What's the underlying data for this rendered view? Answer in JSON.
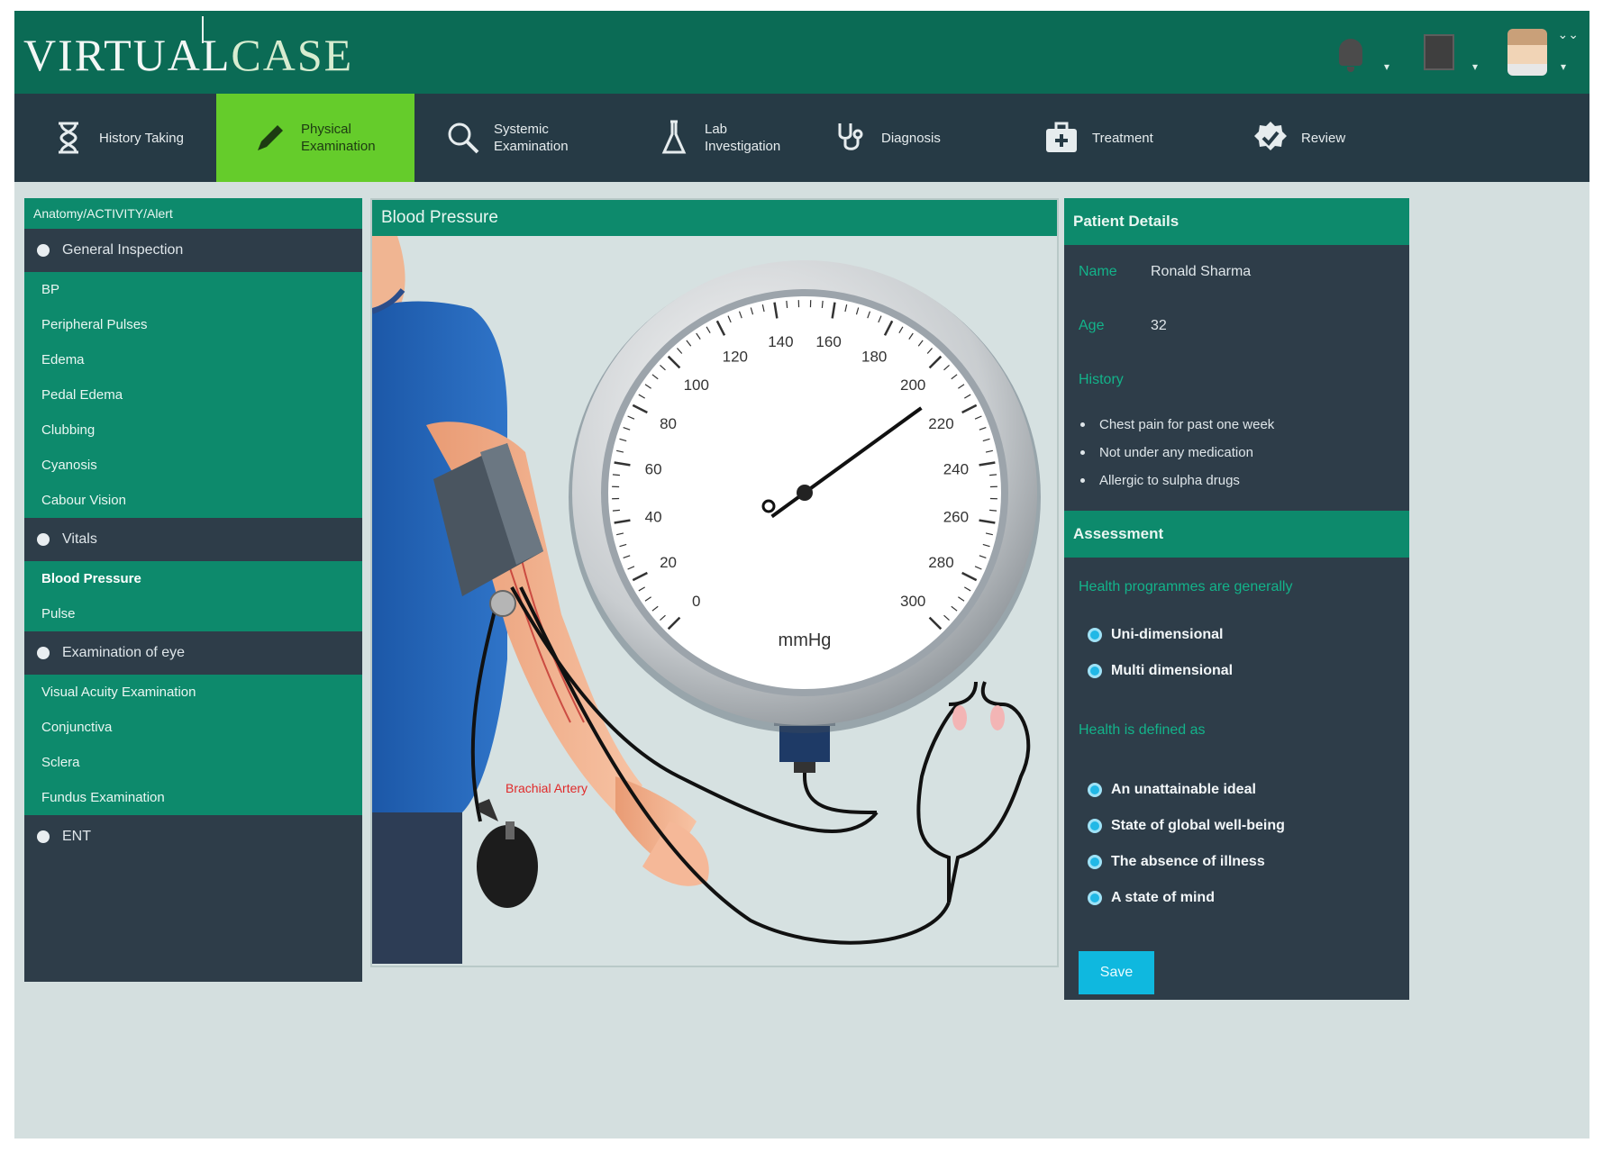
{
  "app": {
    "logo_a": "VIRTUAL",
    "logo_b": "CASE"
  },
  "nav": [
    {
      "label": "History Taking",
      "icon": "hourglass-icon"
    },
    {
      "label": "Physical\nExamination",
      "icon": "pencil-icon",
      "active": true
    },
    {
      "label": "Systemic\nExamination",
      "icon": "search-icon"
    },
    {
      "label": "Lab\nInvestigation",
      "icon": "flask-icon"
    },
    {
      "label": "Diagnosis",
      "icon": "stethoscope-icon"
    },
    {
      "label": "Treatment",
      "icon": "medical-kit-icon"
    },
    {
      "label": "Review",
      "icon": "review-badge-icon"
    }
  ],
  "left_panel": {
    "title": "Anatomy/ACTIVITY/Alert",
    "groups": [
      {
        "label": "General Inspection",
        "items": [
          {
            "label": "BP"
          },
          {
            "label": "Peripheral Pulses"
          },
          {
            "label": "Edema"
          },
          {
            "label": "Pedal Edema"
          },
          {
            "label": "Clubbing"
          },
          {
            "label": "Cyanosis"
          },
          {
            "label": "Cabour Vision"
          }
        ]
      },
      {
        "label": "Vitals",
        "items": [
          {
            "label": "Blood Pressure",
            "selected": true
          },
          {
            "label": "Pulse"
          }
        ]
      },
      {
        "label": "Examination of eye",
        "items": [
          {
            "label": "Visual Acuity Examination"
          },
          {
            "label": "Conjunctiva"
          },
          {
            "label": "Sclera"
          },
          {
            "label": "Fundus Examination"
          }
        ]
      },
      {
        "label": "ENT",
        "items": []
      }
    ]
  },
  "center_panel": {
    "title": "Blood Pressure",
    "gauge": {
      "unit": "mmHg",
      "ticks": [
        "0",
        "20",
        "40",
        "60",
        "80",
        "100",
        "120",
        "140",
        "160",
        "180",
        "200",
        "220",
        "240",
        "260",
        "280",
        "300"
      ],
      "needle_value": 210
    },
    "artery_label": "Brachial Artery"
  },
  "patient": {
    "title": "Patient Details",
    "name_label": "Name",
    "name": "Ronald Sharma",
    "age_label": "Age",
    "age": "32",
    "history_label": "History",
    "history": [
      "Chest pain for past one week",
      "Not under any medication",
      "Allergic to sulpha drugs"
    ]
  },
  "assessment": {
    "title": "Assessment",
    "questions": [
      {
        "text": "Health programmes are generally",
        "options": [
          "Uni-dimensional",
          "Multi dimensional"
        ]
      },
      {
        "text": "Health is defined as",
        "options": [
          "An unattainable ideal",
          "State of global well-being",
          "The absence of illness",
          "A state of mind"
        ]
      }
    ],
    "save_label": "Save"
  },
  "colors": {
    "topbar": "#0b6b55",
    "nav": "#263a45",
    "nav_active": "#65cc2b",
    "panel_head": "#0d8a6c",
    "panel_body": "#2e3d49",
    "accent_text": "#13b38a",
    "button": "#0fb8df"
  }
}
